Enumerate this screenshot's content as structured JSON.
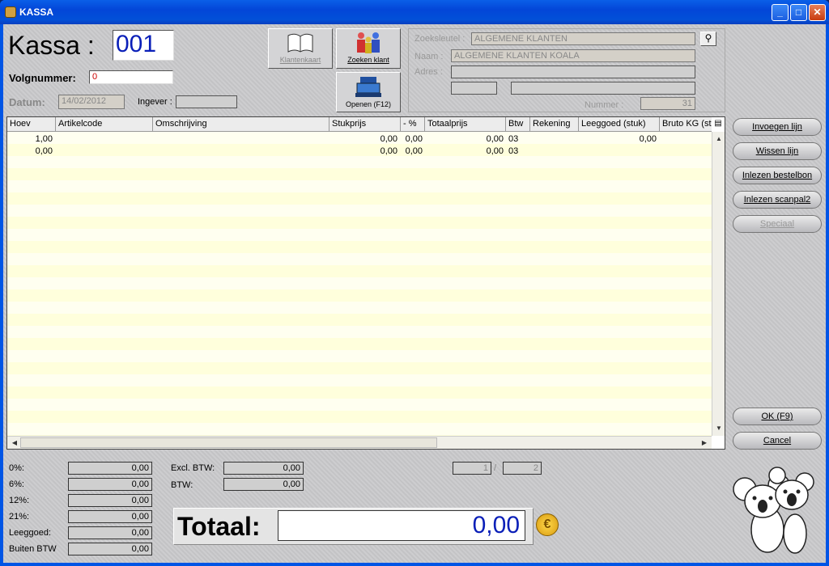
{
  "window": {
    "title": "KASSA"
  },
  "header": {
    "kassa_label": "Kassa :",
    "kassa_value": "001",
    "volgnummer_label": "Volgnummer:",
    "volgnummer_value": "0",
    "datum_label": "Datum:",
    "datum_value": "14/02/2012",
    "ingever_label": "Ingever :",
    "ingever_value": ""
  },
  "toolbar": {
    "klantenkaart": "Klantenkaart",
    "zoeken_klant": "Zoeken klant",
    "openen": "Openen (F12)"
  },
  "customer": {
    "zoeksleutel_label": "Zoeksleutel :",
    "zoeksleutel_value": "ALGEMENE KLANTEN",
    "naam_label": "Naam :",
    "naam_value": "ALGEMENE KLANTEN KOALA",
    "adres_label": "Adres :",
    "adres_value": "",
    "nummer_label": "Nummer :",
    "nummer_value": "31"
  },
  "grid": {
    "columns": [
      "Hoev",
      "Artikelcode",
      "Omschrijving",
      "Stukprijs",
      "- %",
      "Totaalprijs",
      "Btw",
      "Rekening",
      "Leeggoed (stuk)",
      "Bruto KG (stu"
    ],
    "rows": [
      {
        "hoev": "1,00",
        "artikelcode": "",
        "omschrijving": "",
        "stukprijs": "0,00",
        "korting": "0,00",
        "totaalprijs": "0,00",
        "btw": "03",
        "rekening": "",
        "leeggoed": "0,00"
      },
      {
        "hoev": "0,00",
        "artikelcode": "",
        "omschrijving": "",
        "stukprijs": "0,00",
        "korting": "0,00",
        "totaalprijs": "0,00",
        "btw": "03",
        "rekening": "",
        "leeggoed": ""
      }
    ]
  },
  "side_buttons": {
    "invoegen": "Invoegen lijn",
    "wissen": "Wissen lijn",
    "bestelbon": "Inlezen bestelbon",
    "scanpal": "Inlezen scanpal2",
    "speciaal": "Speciaal",
    "ok": "OK (F9)",
    "cancel": "Cancel"
  },
  "vat": {
    "rows": [
      {
        "label": "0%:",
        "value": "0,00"
      },
      {
        "label": "6%:",
        "value": "0,00"
      },
      {
        "label": "12%:",
        "value": "0,00"
      },
      {
        "label": "21%:",
        "value": "0,00"
      },
      {
        "label": "Leeggoed:",
        "value": "0,00"
      },
      {
        "label": "Buiten BTW",
        "value": "0,00"
      }
    ],
    "excl_label": "Excl. BTW:",
    "excl_value": "0,00",
    "btw_label": "BTW:",
    "btw_value": "0,00"
  },
  "pager": {
    "current": "1",
    "separator": "/",
    "total": "2"
  },
  "total": {
    "label": "Totaal:",
    "value": "0,00"
  },
  "colors": {
    "accent": "#0a1fb8",
    "titlebar": "#0a5fe8"
  }
}
